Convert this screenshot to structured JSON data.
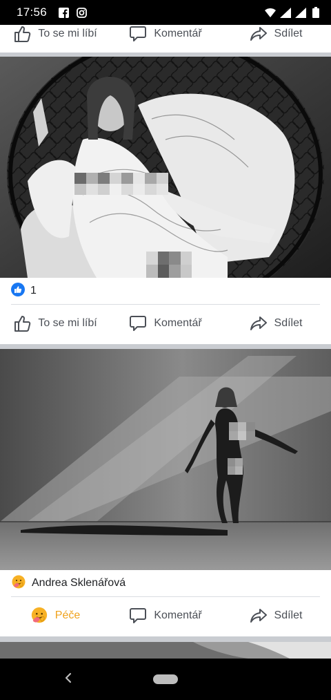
{
  "status_bar": {
    "time": "17:56",
    "left_icons": [
      "facebook-icon",
      "instagram-icon"
    ],
    "right_icons": [
      "wifi-icon",
      "signal-icon",
      "signal-icon-2",
      "battery-icon"
    ]
  },
  "actions": {
    "like_label": "To se mi líbí",
    "comment_label": "Komentář",
    "share_label": "Sdílet",
    "care_label": "Péče"
  },
  "post1": {
    "reaction_icon": "like-reaction-icon",
    "reaction_count": "1"
  },
  "post2": {
    "reaction_icon": "care-reaction-icon",
    "reactor_name": "Andrea Sklenářová"
  },
  "colors": {
    "care": "#f0a21b",
    "like_blue": "#1877f2",
    "text": "#4b4f56",
    "feed_bg": "#c9ccd1"
  },
  "nav_bar": {
    "icons": [
      "back-icon",
      "home-pill"
    ]
  }
}
